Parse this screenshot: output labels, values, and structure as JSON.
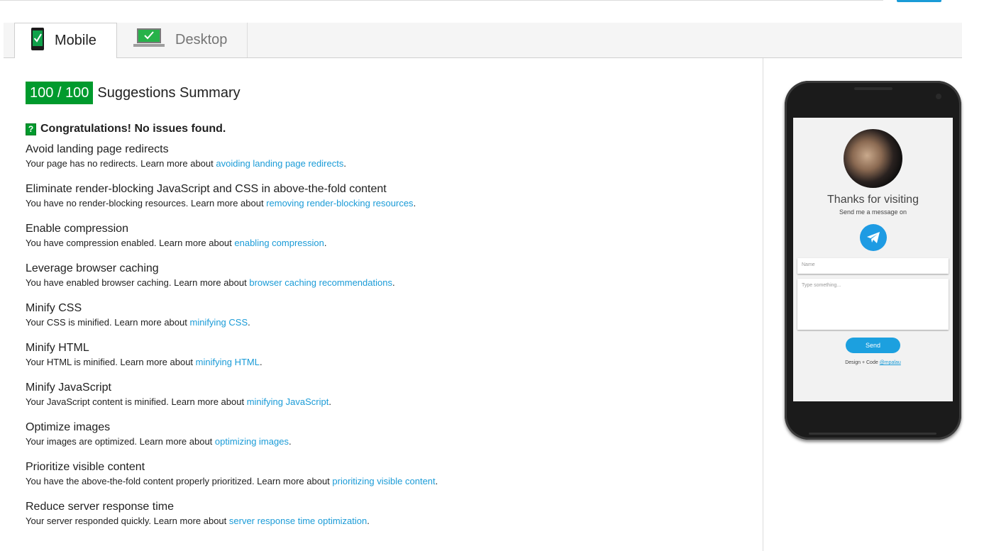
{
  "tabs": [
    {
      "label": "Mobile",
      "icon": "mobile-phone-check-icon",
      "active": true
    },
    {
      "label": "Desktop",
      "icon": "desktop-monitor-check-icon",
      "active": false
    }
  ],
  "summary": {
    "score": "100 / 100",
    "title": "Suggestions Summary",
    "congrats": "Congratulations! No issues found.",
    "accent_color": "#009a2d",
    "link_color": "#1a9bd7"
  },
  "rules": [
    {
      "title": "Avoid landing page redirects",
      "desc": "Your page has no redirects. Learn more about ",
      "link": "avoiding landing page redirects"
    },
    {
      "title": "Eliminate render-blocking JavaScript and CSS in above-the-fold content",
      "desc": "You have no render-blocking resources. Learn more about ",
      "link": "removing render-blocking resources"
    },
    {
      "title": "Enable compression",
      "desc": "You have compression enabled. Learn more about ",
      "link": "enabling compression"
    },
    {
      "title": "Leverage browser caching",
      "desc": "You have enabled browser caching. Learn more about ",
      "link": "browser caching recommendations"
    },
    {
      "title": "Minify CSS",
      "desc": "Your CSS is minified. Learn more about ",
      "link": "minifying CSS"
    },
    {
      "title": "Minify HTML",
      "desc": "Your HTML is minified. Learn more about ",
      "link": "minifying HTML"
    },
    {
      "title": "Minify JavaScript",
      "desc": "Your JavaScript content is minified. Learn more about ",
      "link": "minifying JavaScript"
    },
    {
      "title": "Optimize images",
      "desc": "Your images are optimized. Learn more about ",
      "link": "optimizing images"
    },
    {
      "title": "Prioritize visible content",
      "desc": "You have the above-the-fold content properly prioritized. Learn more about ",
      "link": "prioritizing visible content"
    },
    {
      "title": "Reduce server response time",
      "desc": "Your server responded quickly. Learn more about ",
      "link": "server response time optimization"
    }
  ],
  "preview": {
    "heading": "Thanks for visiting",
    "subheading": "Send me a message on",
    "name_placeholder": "Name",
    "message_placeholder": "Type something...",
    "send_label": "Send",
    "credit_prefix": "Design + Code ",
    "credit_link": "@mpalau",
    "telegram_icon": "telegram-icon"
  }
}
